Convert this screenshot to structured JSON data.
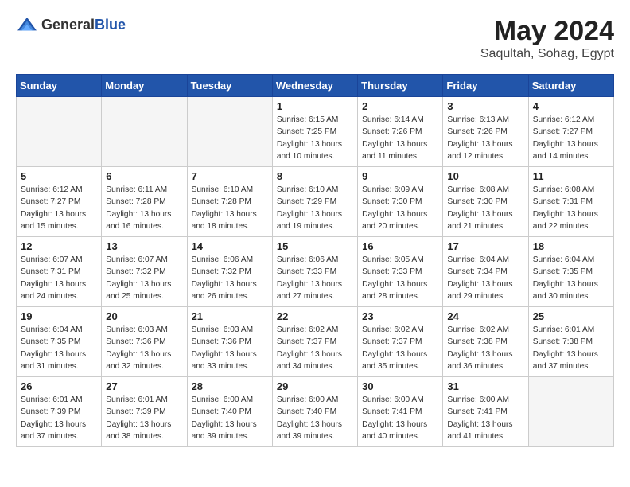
{
  "header": {
    "logo_general": "General",
    "logo_blue": "Blue",
    "month_year": "May 2024",
    "location": "Saqultah, Sohag, Egypt"
  },
  "weekdays": [
    "Sunday",
    "Monday",
    "Tuesday",
    "Wednesday",
    "Thursday",
    "Friday",
    "Saturday"
  ],
  "weeks": [
    [
      {
        "day": "",
        "sunrise": "",
        "sunset": "",
        "daylight": "",
        "empty": true
      },
      {
        "day": "",
        "sunrise": "",
        "sunset": "",
        "daylight": "",
        "empty": true
      },
      {
        "day": "",
        "sunrise": "",
        "sunset": "",
        "daylight": "",
        "empty": true
      },
      {
        "day": "1",
        "sunrise": "Sunrise: 6:15 AM",
        "sunset": "Sunset: 7:25 PM",
        "daylight": "Daylight: 13 hours and 10 minutes.",
        "empty": false
      },
      {
        "day": "2",
        "sunrise": "Sunrise: 6:14 AM",
        "sunset": "Sunset: 7:26 PM",
        "daylight": "Daylight: 13 hours and 11 minutes.",
        "empty": false
      },
      {
        "day": "3",
        "sunrise": "Sunrise: 6:13 AM",
        "sunset": "Sunset: 7:26 PM",
        "daylight": "Daylight: 13 hours and 12 minutes.",
        "empty": false
      },
      {
        "day": "4",
        "sunrise": "Sunrise: 6:12 AM",
        "sunset": "Sunset: 7:27 PM",
        "daylight": "Daylight: 13 hours and 14 minutes.",
        "empty": false
      }
    ],
    [
      {
        "day": "5",
        "sunrise": "Sunrise: 6:12 AM",
        "sunset": "Sunset: 7:27 PM",
        "daylight": "Daylight: 13 hours and 15 minutes.",
        "empty": false
      },
      {
        "day": "6",
        "sunrise": "Sunrise: 6:11 AM",
        "sunset": "Sunset: 7:28 PM",
        "daylight": "Daylight: 13 hours and 16 minutes.",
        "empty": false
      },
      {
        "day": "7",
        "sunrise": "Sunrise: 6:10 AM",
        "sunset": "Sunset: 7:28 PM",
        "daylight": "Daylight: 13 hours and 18 minutes.",
        "empty": false
      },
      {
        "day": "8",
        "sunrise": "Sunrise: 6:10 AM",
        "sunset": "Sunset: 7:29 PM",
        "daylight": "Daylight: 13 hours and 19 minutes.",
        "empty": false
      },
      {
        "day": "9",
        "sunrise": "Sunrise: 6:09 AM",
        "sunset": "Sunset: 7:30 PM",
        "daylight": "Daylight: 13 hours and 20 minutes.",
        "empty": false
      },
      {
        "day": "10",
        "sunrise": "Sunrise: 6:08 AM",
        "sunset": "Sunset: 7:30 PM",
        "daylight": "Daylight: 13 hours and 21 minutes.",
        "empty": false
      },
      {
        "day": "11",
        "sunrise": "Sunrise: 6:08 AM",
        "sunset": "Sunset: 7:31 PM",
        "daylight": "Daylight: 13 hours and 22 minutes.",
        "empty": false
      }
    ],
    [
      {
        "day": "12",
        "sunrise": "Sunrise: 6:07 AM",
        "sunset": "Sunset: 7:31 PM",
        "daylight": "Daylight: 13 hours and 24 minutes.",
        "empty": false
      },
      {
        "day": "13",
        "sunrise": "Sunrise: 6:07 AM",
        "sunset": "Sunset: 7:32 PM",
        "daylight": "Daylight: 13 hours and 25 minutes.",
        "empty": false
      },
      {
        "day": "14",
        "sunrise": "Sunrise: 6:06 AM",
        "sunset": "Sunset: 7:32 PM",
        "daylight": "Daylight: 13 hours and 26 minutes.",
        "empty": false
      },
      {
        "day": "15",
        "sunrise": "Sunrise: 6:06 AM",
        "sunset": "Sunset: 7:33 PM",
        "daylight": "Daylight: 13 hours and 27 minutes.",
        "empty": false
      },
      {
        "day": "16",
        "sunrise": "Sunrise: 6:05 AM",
        "sunset": "Sunset: 7:33 PM",
        "daylight": "Daylight: 13 hours and 28 minutes.",
        "empty": false
      },
      {
        "day": "17",
        "sunrise": "Sunrise: 6:04 AM",
        "sunset": "Sunset: 7:34 PM",
        "daylight": "Daylight: 13 hours and 29 minutes.",
        "empty": false
      },
      {
        "day": "18",
        "sunrise": "Sunrise: 6:04 AM",
        "sunset": "Sunset: 7:35 PM",
        "daylight": "Daylight: 13 hours and 30 minutes.",
        "empty": false
      }
    ],
    [
      {
        "day": "19",
        "sunrise": "Sunrise: 6:04 AM",
        "sunset": "Sunset: 7:35 PM",
        "daylight": "Daylight: 13 hours and 31 minutes.",
        "empty": false
      },
      {
        "day": "20",
        "sunrise": "Sunrise: 6:03 AM",
        "sunset": "Sunset: 7:36 PM",
        "daylight": "Daylight: 13 hours and 32 minutes.",
        "empty": false
      },
      {
        "day": "21",
        "sunrise": "Sunrise: 6:03 AM",
        "sunset": "Sunset: 7:36 PM",
        "daylight": "Daylight: 13 hours and 33 minutes.",
        "empty": false
      },
      {
        "day": "22",
        "sunrise": "Sunrise: 6:02 AM",
        "sunset": "Sunset: 7:37 PM",
        "daylight": "Daylight: 13 hours and 34 minutes.",
        "empty": false
      },
      {
        "day": "23",
        "sunrise": "Sunrise: 6:02 AM",
        "sunset": "Sunset: 7:37 PM",
        "daylight": "Daylight: 13 hours and 35 minutes.",
        "empty": false
      },
      {
        "day": "24",
        "sunrise": "Sunrise: 6:02 AM",
        "sunset": "Sunset: 7:38 PM",
        "daylight": "Daylight: 13 hours and 36 minutes.",
        "empty": false
      },
      {
        "day": "25",
        "sunrise": "Sunrise: 6:01 AM",
        "sunset": "Sunset: 7:38 PM",
        "daylight": "Daylight: 13 hours and 37 minutes.",
        "empty": false
      }
    ],
    [
      {
        "day": "26",
        "sunrise": "Sunrise: 6:01 AM",
        "sunset": "Sunset: 7:39 PM",
        "daylight": "Daylight: 13 hours and 37 minutes.",
        "empty": false
      },
      {
        "day": "27",
        "sunrise": "Sunrise: 6:01 AM",
        "sunset": "Sunset: 7:39 PM",
        "daylight": "Daylight: 13 hours and 38 minutes.",
        "empty": false
      },
      {
        "day": "28",
        "sunrise": "Sunrise: 6:00 AM",
        "sunset": "Sunset: 7:40 PM",
        "daylight": "Daylight: 13 hours and 39 minutes.",
        "empty": false
      },
      {
        "day": "29",
        "sunrise": "Sunrise: 6:00 AM",
        "sunset": "Sunset: 7:40 PM",
        "daylight": "Daylight: 13 hours and 39 minutes.",
        "empty": false
      },
      {
        "day": "30",
        "sunrise": "Sunrise: 6:00 AM",
        "sunset": "Sunset: 7:41 PM",
        "daylight": "Daylight: 13 hours and 40 minutes.",
        "empty": false
      },
      {
        "day": "31",
        "sunrise": "Sunrise: 6:00 AM",
        "sunset": "Sunset: 7:41 PM",
        "daylight": "Daylight: 13 hours and 41 minutes.",
        "empty": false
      },
      {
        "day": "",
        "sunrise": "",
        "sunset": "",
        "daylight": "",
        "empty": true
      }
    ]
  ]
}
